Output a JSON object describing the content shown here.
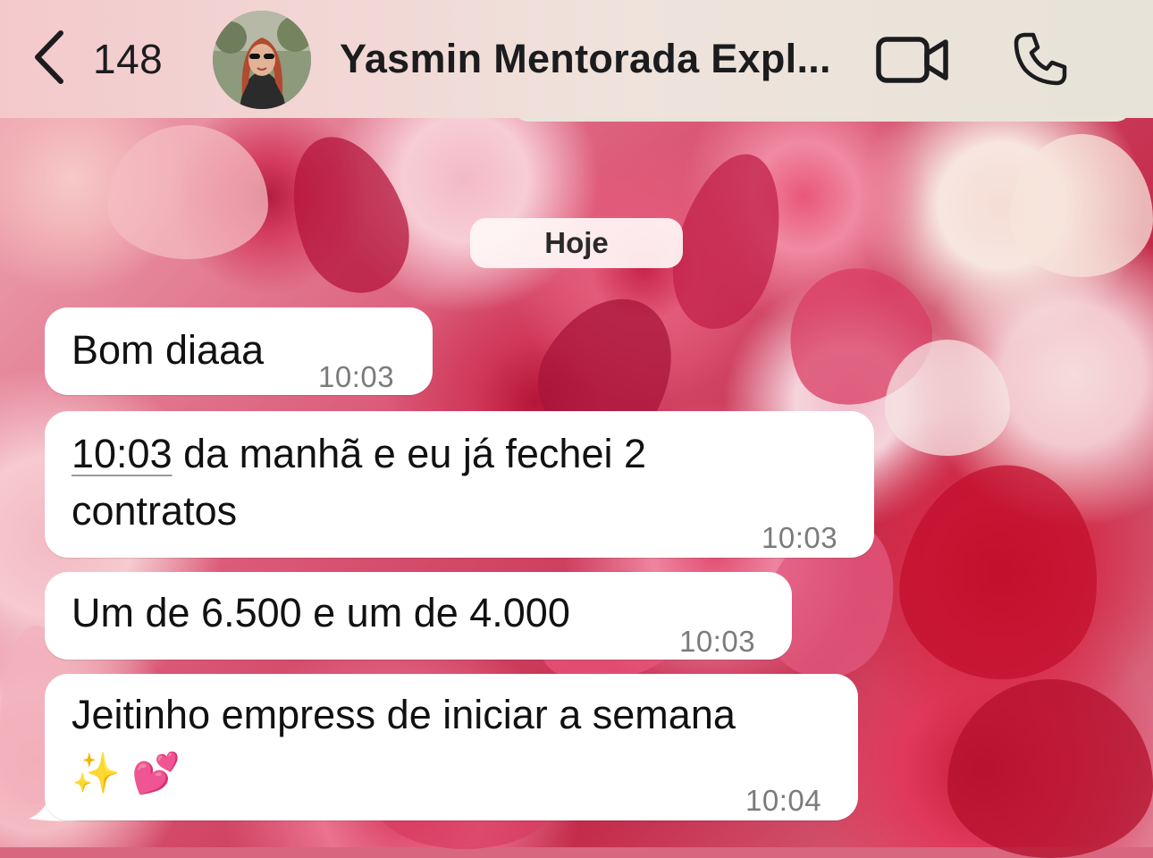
{
  "header": {
    "back_count": "148",
    "contact_name": "Yasmin Mentorada Expl...",
    "icons": [
      "chevron-left-icon",
      "video-camera-icon",
      "phone-icon"
    ]
  },
  "chat": {
    "date_label": "Hoje",
    "messages": [
      {
        "text": "Bom diaaa",
        "time": "10:03"
      },
      {
        "link_time": "10:03",
        "text_line1": " da manhã e eu já fechei 2",
        "text_line2": "contratos",
        "time": "10:03"
      },
      {
        "text": "Um de 6.500 e um de 4.000",
        "time": "10:03"
      },
      {
        "text_line1": "Jeitinho empress de iniciar a semana",
        "text_line2": "✨ 💕",
        "time": "10:04"
      }
    ]
  },
  "colors": {
    "header_bg": "#efe3dc",
    "bubble_bg": "#ffffff",
    "timestamp": "#7b7b7b",
    "text": "#111111"
  }
}
